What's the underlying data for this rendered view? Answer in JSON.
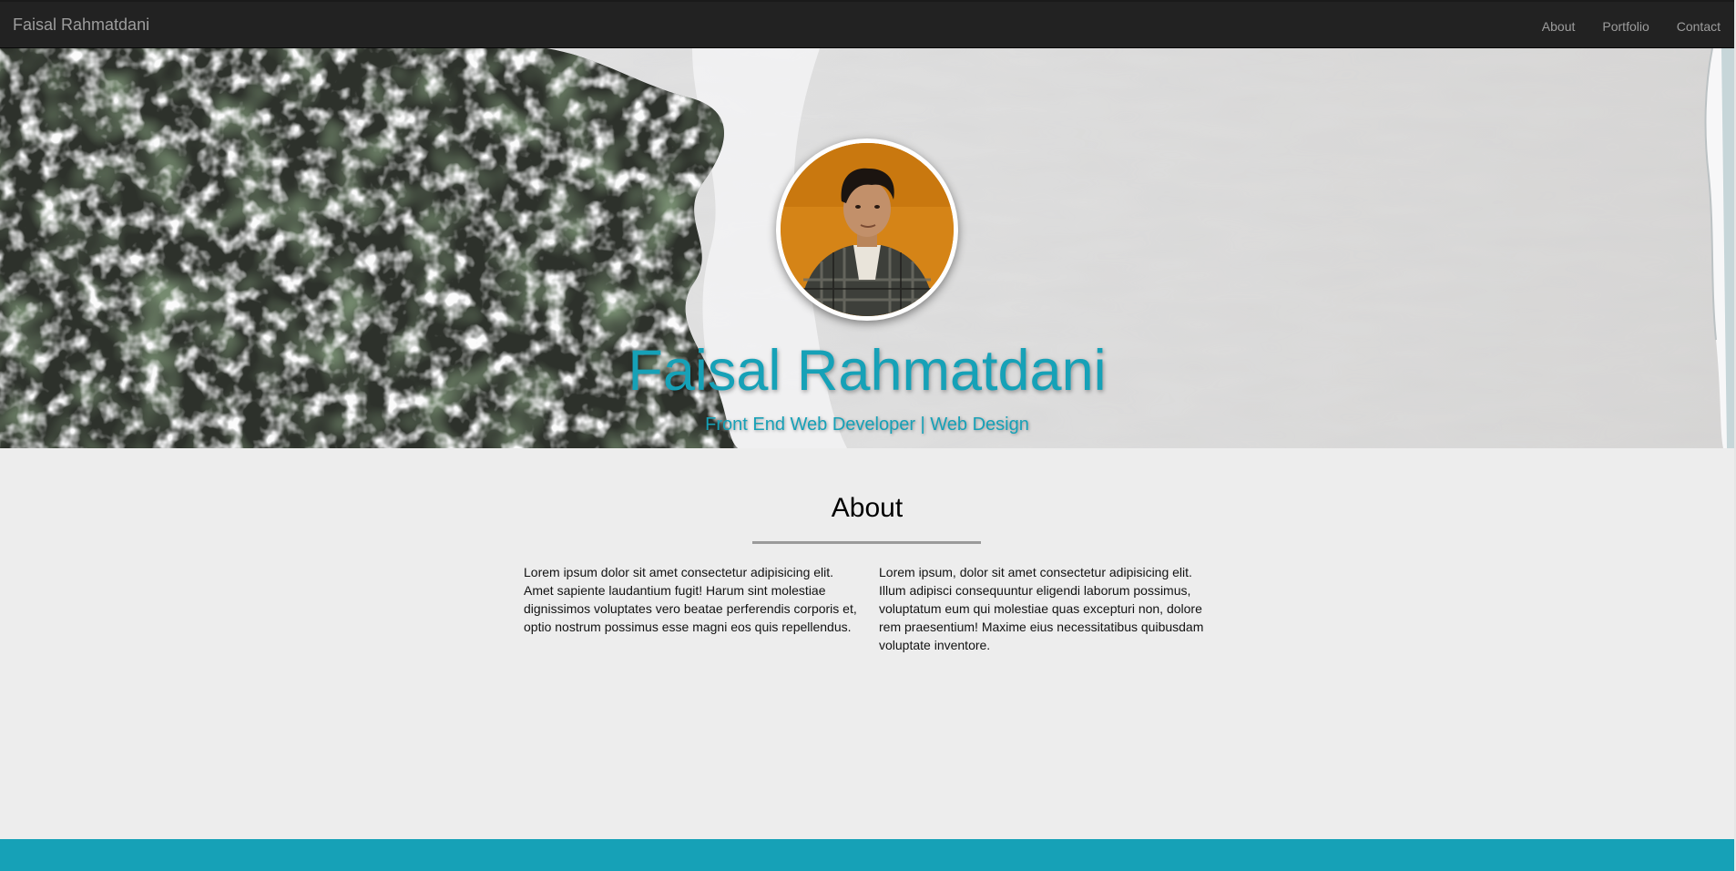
{
  "navbar": {
    "brand": "Faisal Rahmatdani",
    "links": [
      "About",
      "Portfolio",
      "Contact"
    ]
  },
  "hero": {
    "name": "Faisal Rahmatdani",
    "subtitle": "Front End Web Developer | Web Design",
    "accent_color": "#16a1b7"
  },
  "about": {
    "title": "About",
    "paragraphs": [
      "Lorem ipsum dolor sit amet consectetur adipisicing elit. Amet sapiente laudantium fugit! Harum sint molestiae dignissimos voluptates vero beatae perferendis corporis et, optio nostrum possimus esse magni eos quis repellendus.",
      "Lorem ipsum, dolor sit amet consectetur adipisicing elit. Illum adipisci consequuntur eligendi laborum possimus, voluptatum eum qui molestiae quas excepturi non, dolore rem praesentium! Maxime eius necessitatibus quibusdam voluptate inventore."
    ]
  },
  "colors": {
    "navbar_bg": "#222222",
    "page_bg": "#ededed",
    "footer_bg": "#16a1b7"
  }
}
